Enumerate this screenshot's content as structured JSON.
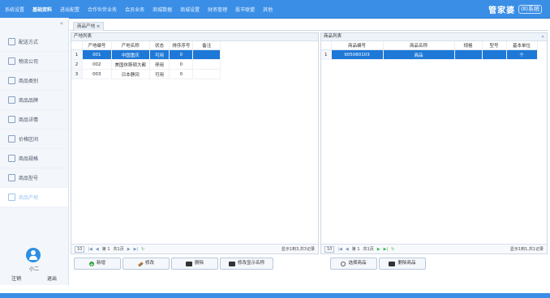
{
  "topnav": [
    "系统设置",
    "基础资料",
    "进出配置",
    "合作伙伴业务",
    "会员业务",
    "商城数据",
    "商城设置",
    "财务管理",
    "股市联盟",
    "其他"
  ],
  "brand": {
    "main": "管家婆",
    "sub": "(Ⅱ)系统"
  },
  "sidebar": {
    "collapse_icon": "«",
    "items": [
      {
        "label": "配送方式",
        "icon": "doc-icon"
      },
      {
        "label": "物流公司",
        "icon": "truck-icon"
      },
      {
        "label": "商品类别",
        "icon": "folder-icon"
      },
      {
        "label": "商品品牌",
        "icon": "tag-icon"
      },
      {
        "label": "商品详情",
        "icon": "search-icon"
      },
      {
        "label": "价格区间",
        "icon": "price-icon"
      },
      {
        "label": "商品规格",
        "icon": "grid-icon"
      },
      {
        "label": "商品型号",
        "icon": "model-icon"
      },
      {
        "label": "商品产地",
        "icon": "location-icon"
      }
    ],
    "active_index": 8
  },
  "user": {
    "name": "小二",
    "logout": "注销",
    "exit": "退出"
  },
  "tab": {
    "label": "商品产地 ×"
  },
  "left_panel": {
    "title": "产地列表",
    "columns": [
      "产地编号",
      "产地名称",
      "状态",
      "排序序号",
      "备注"
    ],
    "rows": [
      {
        "no": "1",
        "code": "001",
        "name": "中国重庆",
        "status": "可用",
        "sort": "0",
        "note": "",
        "selected": true
      },
      {
        "no": "2",
        "code": "002",
        "name": "美国休斯顿大都",
        "status": "停用",
        "sort": "0",
        "note": "",
        "selected": false
      },
      {
        "no": "3",
        "code": "003",
        "name": "日本静冈",
        "status": "可用",
        "sort": "0",
        "note": "",
        "selected": false
      }
    ],
    "pager": {
      "size": "10",
      "page_label": "第 1",
      "total_pages": "共1页",
      "info": "显示1到3,共3记录"
    }
  },
  "right_panel": {
    "title": "商品列表",
    "collapse_icon": "»",
    "columns": [
      "商品编号",
      "商品名称",
      "规格",
      "型号",
      "基本单位"
    ],
    "rows": [
      {
        "no": "1",
        "code": "905080103",
        "name": "商品",
        "spec": "",
        "model": "",
        "unit": "个",
        "selected": true
      }
    ],
    "pager": {
      "size": "10",
      "page_label": "第 1",
      "total_pages": "共1页",
      "info": "显示1到1,共1记录"
    }
  },
  "buttons_left": [
    {
      "label": "新增",
      "icon": "plus-icon"
    },
    {
      "label": "修改",
      "icon": "edit-icon"
    },
    {
      "label": "删除",
      "icon": "delete-icon"
    },
    {
      "label": "修改显示名称",
      "icon": "rename-icon"
    }
  ],
  "buttons_right": [
    {
      "label": "选择商品",
      "icon": "search-icon"
    },
    {
      "label": "删除商品",
      "icon": "delete-icon"
    }
  ],
  "pager_glyphs": {
    "first": "|◀",
    "prev": "◀",
    "next": "▶",
    "last": "▶|",
    "refresh": "↻"
  }
}
